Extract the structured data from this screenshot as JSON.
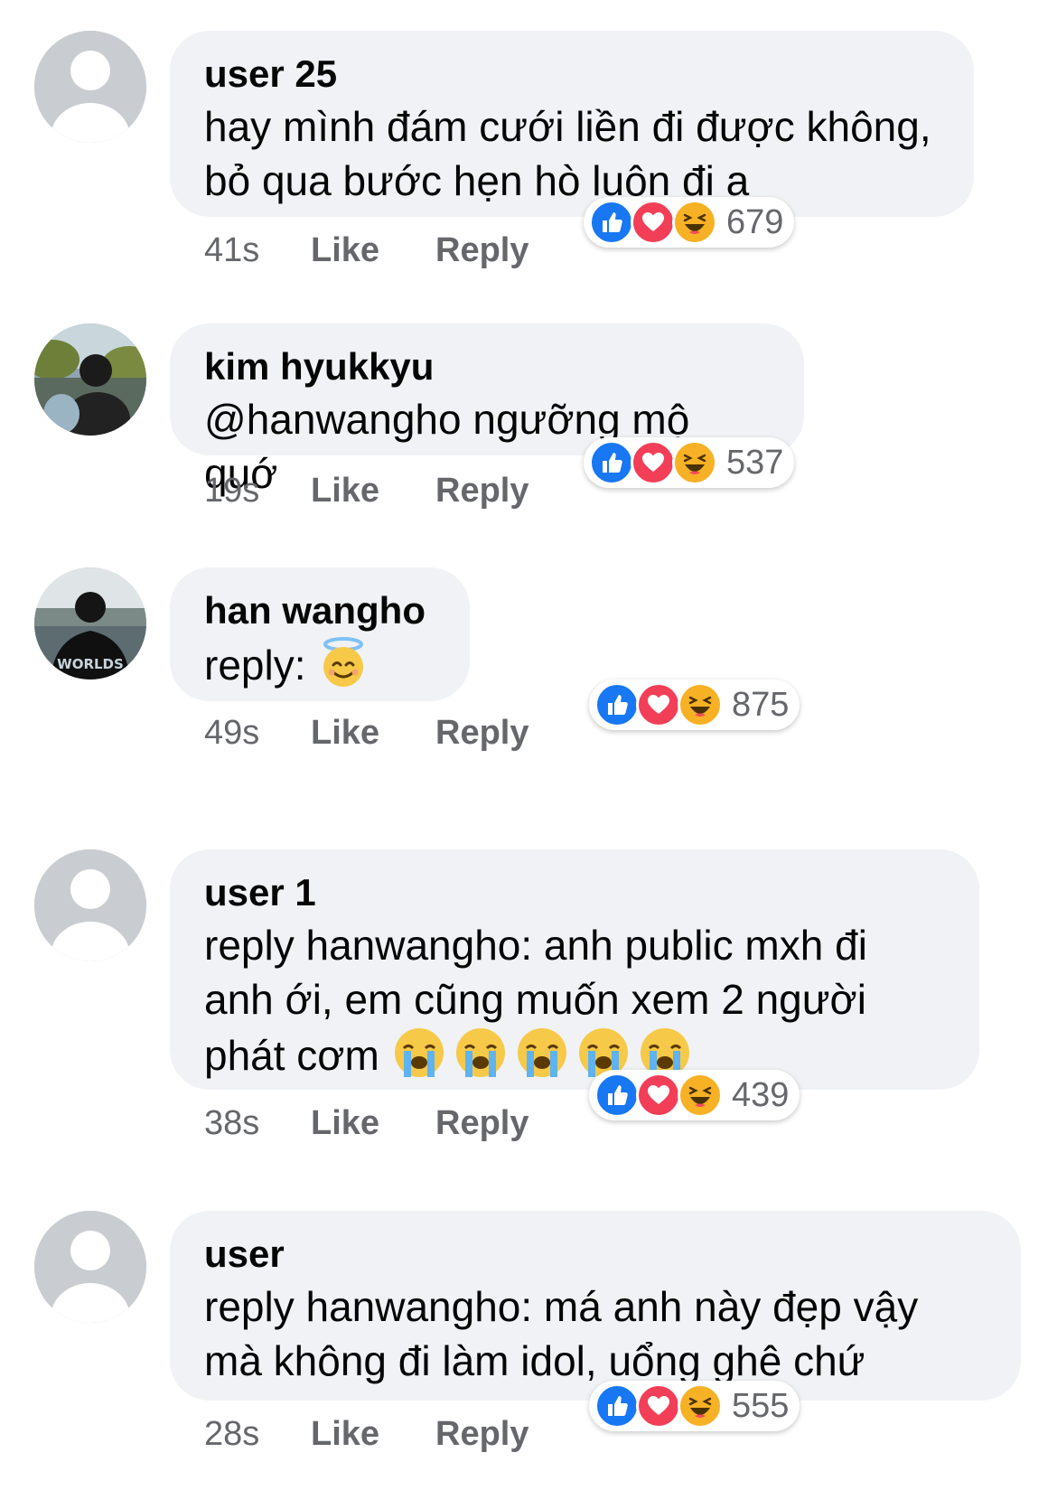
{
  "colors": {
    "bubble_bg": "#f0f2f5",
    "meta_text": "#65676b",
    "like_blue": "#1877f2",
    "love_red": "#f33e58",
    "haha_yellow": "#f7b125"
  },
  "comments": [
    {
      "author": "user 25",
      "text": "hay mình đám cưới liền đi được không,\nbỏ qua bước hẹn hò luôn đi ạ",
      "time": "41s",
      "like_label": "Like",
      "reply_label": "Reply",
      "reaction_count": "679",
      "reactions": [
        "like-icon",
        "love-icon",
        "haha-icon"
      ],
      "avatar": "default-avatar"
    },
    {
      "author": "kim hyukkyu",
      "text": "@hanwangho ngưỡng mộ quớ",
      "time": "19s",
      "like_label": "Like",
      "reply_label": "Reply",
      "reaction_count": "537",
      "reactions": [
        "like-icon",
        "love-icon",
        "haha-icon"
      ],
      "avatar": "photo-avatar"
    },
    {
      "author": "han wangho",
      "text": "reply: ",
      "text_emoji": "smiling-halo-emoji",
      "time": "49s",
      "like_label": "Like",
      "reply_label": "Reply",
      "reaction_count": "875",
      "reactions": [
        "like-icon",
        "love-icon",
        "haha-icon"
      ],
      "avatar": "photo-avatar"
    },
    {
      "author": "user 1",
      "text": "reply hanwangho: anh public mxh đi\nanh ới, em cũng muốn xem 2 người\nphát cơm ",
      "text_emoji": "crying-face-emoji x5",
      "time": "38s",
      "like_label": "Like",
      "reply_label": "Reply",
      "reaction_count": "439",
      "reactions": [
        "like-icon",
        "love-icon",
        "haha-icon"
      ],
      "avatar": "default-avatar"
    },
    {
      "author": "user",
      "text": "reply hanwangho: má anh này đẹp vậy\nmà không đi làm idol, uổng ghê chứ",
      "time": "28s",
      "like_label": "Like",
      "reply_label": "Reply",
      "reaction_count": "555",
      "reactions": [
        "like-icon",
        "love-icon",
        "haha-icon"
      ],
      "avatar": "default-avatar"
    }
  ]
}
